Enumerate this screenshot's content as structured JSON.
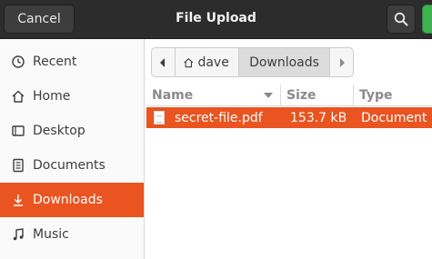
{
  "header": {
    "title": "File Upload",
    "cancel_label": "Cancel"
  },
  "sidebar": {
    "items": [
      {
        "label": "Recent",
        "icon": "clock-icon"
      },
      {
        "label": "Home",
        "icon": "home-icon"
      },
      {
        "label": "Desktop",
        "icon": "desktop-icon"
      },
      {
        "label": "Documents",
        "icon": "document-icon"
      },
      {
        "label": "Downloads",
        "icon": "download-icon",
        "active": true
      },
      {
        "label": "Music",
        "icon": "music-icon"
      }
    ]
  },
  "pathbar": {
    "crumbs": [
      "dave",
      "Downloads"
    ]
  },
  "file_list": {
    "columns": [
      "Name",
      "Size",
      "Type"
    ],
    "rows": [
      {
        "name": "secret-file.pdf",
        "size": "153.7 kB",
        "type": "Document",
        "selected": true
      }
    ]
  },
  "colors": {
    "accent": "#e95420",
    "header_bg": "#2c2c2c",
    "open_button": "#3eb34f"
  }
}
